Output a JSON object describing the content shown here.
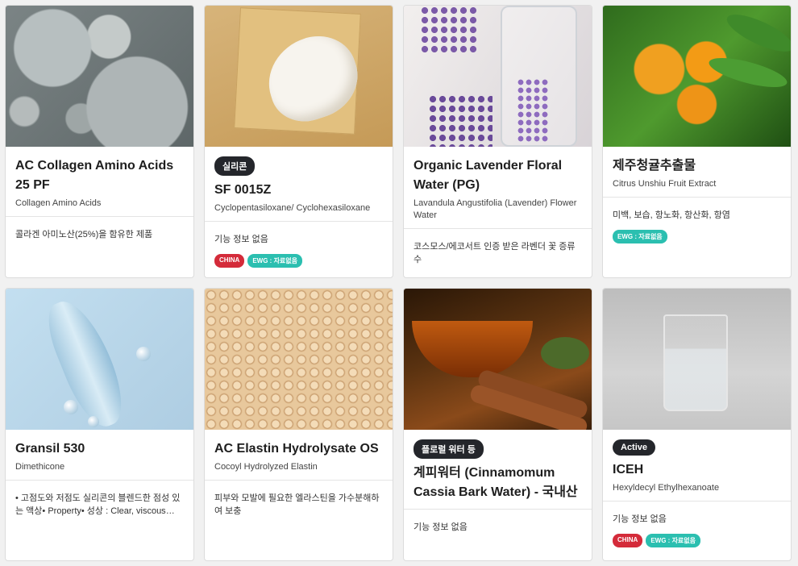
{
  "cards": [
    {
      "badge": "",
      "title": "AC Collagen Amino Acids 25 PF",
      "subtitle": "Collagen Amino Acids",
      "description": "콜라겐 아미노산(25%)을 함유한 제품",
      "tags": []
    },
    {
      "badge": "실리콘",
      "title": "SF 0015Z",
      "subtitle": "Cyclopentasiloxane/ Cyclohexasiloxane",
      "description": "기능 정보 없음",
      "tags": [
        "CHINA",
        "EWG : 자료없음"
      ]
    },
    {
      "badge": "",
      "title": "Organic Lavender Floral Water (PG)",
      "subtitle": "Lavandula Angustifolia (Lavender) Flower Water",
      "description": "코스모스/에코서트 인증 받은 라벤더 꽃 증류수",
      "tags": []
    },
    {
      "badge": "",
      "title": "제주청귤추출물",
      "subtitle": "Citrus Unshiu Fruit Extract",
      "description": "미백, 보습, 항노화, 항산화, 항염",
      "tags": [
        "EWG : 자료없음"
      ]
    },
    {
      "badge": "",
      "title": "Gransil 530",
      "subtitle": "Dimethicone",
      "description": "• 고점도와 저점도 실리콘의 블렌드한 점성 있는 액상• Property• 성상 : Clear, viscous liquid",
      "tags": []
    },
    {
      "badge": "",
      "title": "AC Elastin Hydrolysate OS",
      "subtitle": "Cocoyl Hydrolyzed Elastin",
      "description": "피부와 모발에 필요한 엘라스틴을 가수분해하여 보충",
      "tags": []
    },
    {
      "badge": "플로럴 워터 등",
      "title": "계피워터 (Cinnamomum Cassia Bark Water) - 국내산",
      "subtitle": "",
      "description": "기능 정보 없음",
      "tags": []
    },
    {
      "badge": "Active",
      "title": "ICEH",
      "subtitle": "Hexyldecyl Ethylhexanoate",
      "description": "기능 정보 없음",
      "tags": [
        "CHINA",
        "EWG : 자료없음"
      ]
    }
  ]
}
